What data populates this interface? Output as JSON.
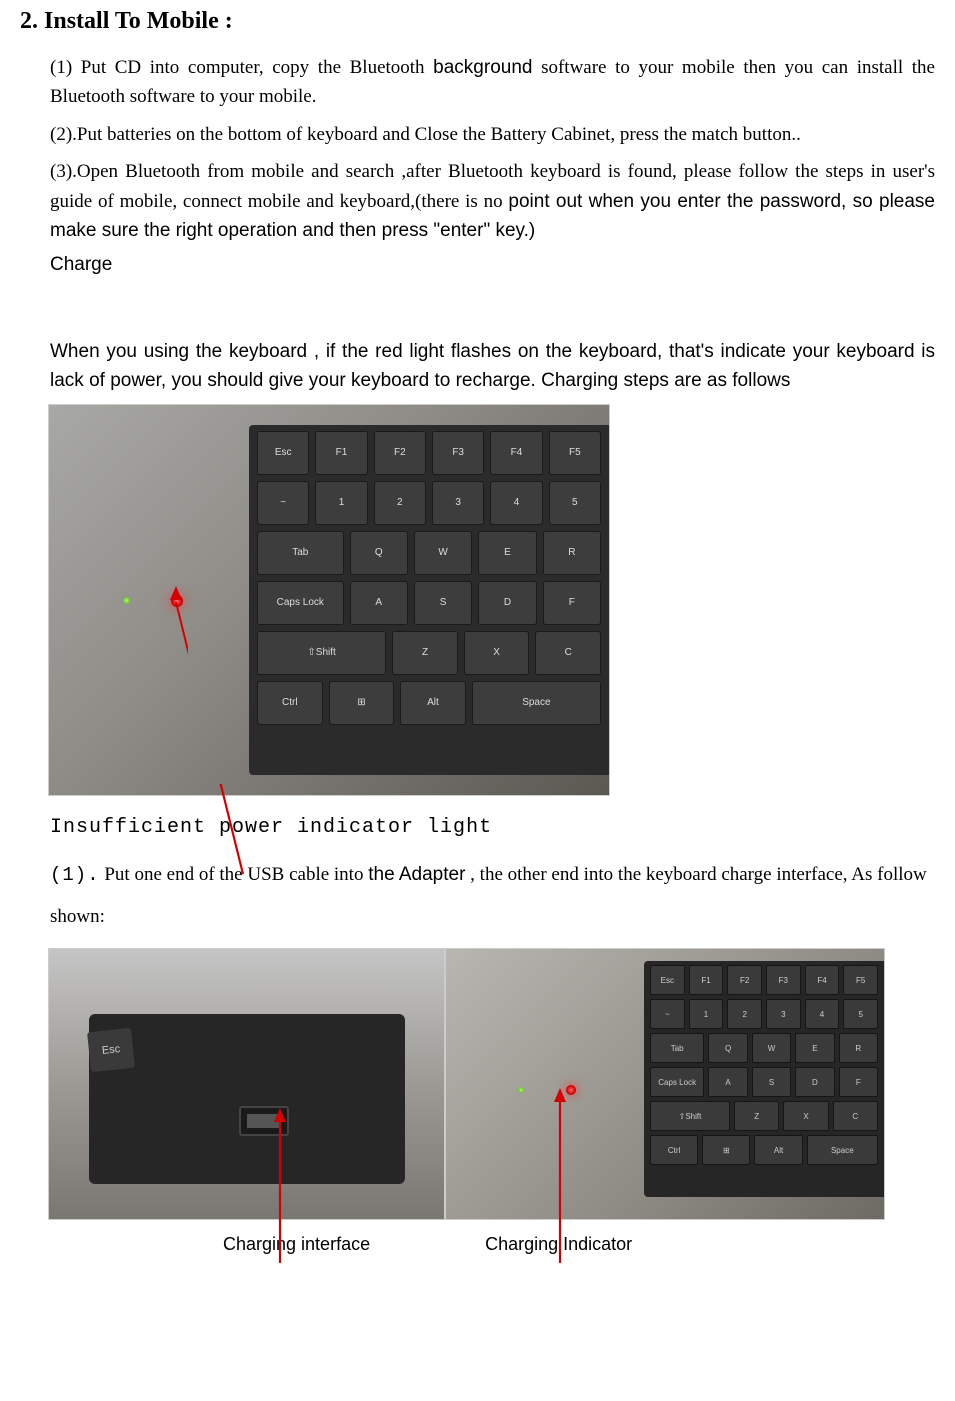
{
  "title": "2. Install To Mobile :",
  "p1_a": "(1) Put CD into computer, copy the Bluetooth ",
  "p1_b": "background",
  "p1_c": " software to your mobile then you can install the Bluetooth software to your mobile.",
  "p2": "(2).Put batteries on the bottom of keyboard and Close the Battery Cabinet, press the match button..",
  "p3_a": "(3).Open Bluetooth from mobile and search ,after Bluetooth keyboard is found, please follow the steps in user's guide of mobile, connect mobile and keyboard,(there is no ",
  "p3_b": "point out when you enter the password, so please make sure the right operation and then press \"enter\" key.)",
  "charge": "Charge",
  "warn": "When you using the keyboard , if the red light flashes on the keyboard, that's indicate your keyboard is lack of power, you should give your keyboard to recharge. Charging steps are as follows",
  "label1": "Insufficient power indicator light",
  "step_pre": "(1).",
  "step_a": " Put one end of the   USB cable   into ",
  "step_b": "the Adapter",
  "step_c": "  , the other end into the keyboard charge interface, As follow shown:",
  "bottom_left": "Charging   interface",
  "bottom_right": "Charging Indicator",
  "kb": {
    "esc": "Esc",
    "f1": "F1",
    "f2": "F2",
    "f3": "F3",
    "f4": "F4",
    "f5": "F5",
    "tilde": "~",
    "n1": "1",
    "n2": "2",
    "n3": "3",
    "n4": "4",
    "n5": "5",
    "tab": "Tab",
    "q": "Q",
    "w": "W",
    "e": "E",
    "r": "R",
    "caps": "Caps Lock",
    "a": "A",
    "s": "S",
    "d": "D",
    "f": "F",
    "shift": "⇧Shift",
    "z": "Z",
    "x": "X",
    "c": "C",
    "ctrl": "Ctrl",
    "win": "⊞",
    "alt": "Alt",
    "space": "Space"
  }
}
